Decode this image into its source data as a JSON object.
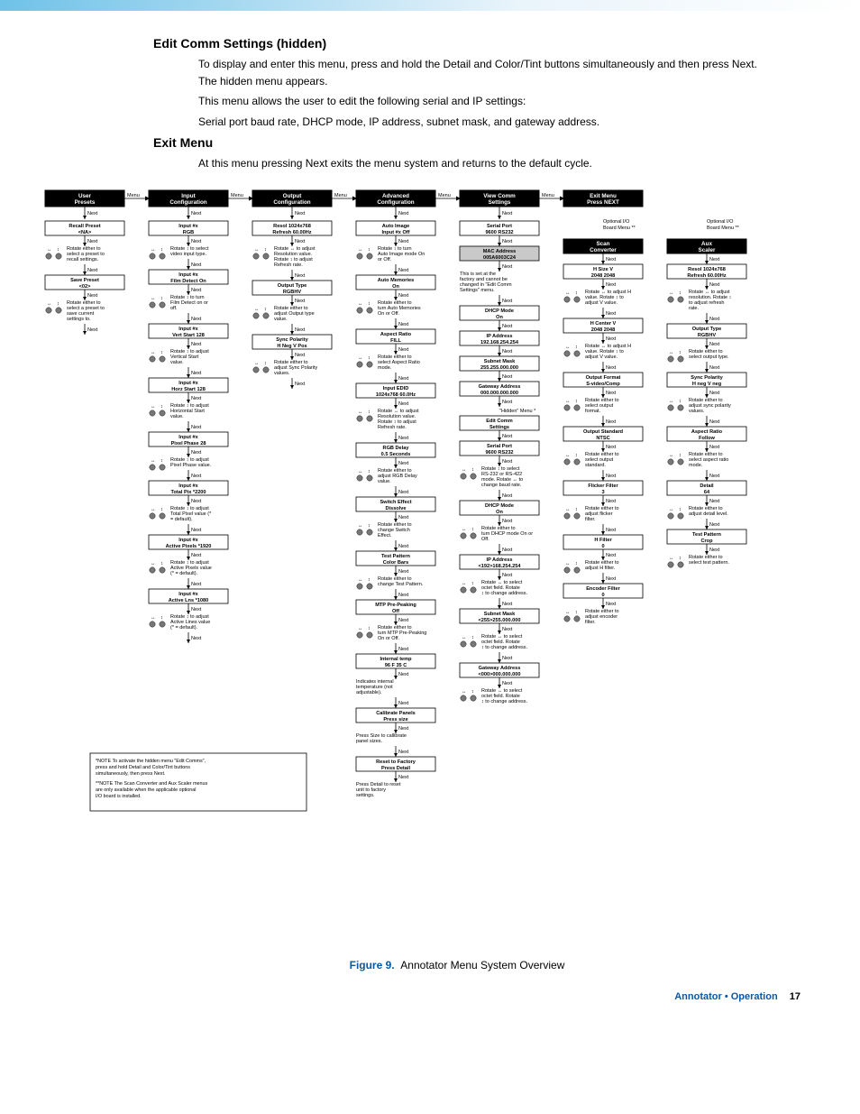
{
  "page_header_bar": true,
  "heading1": "Edit Comm Settings (hidden)",
  "para1": "To display and enter this menu, press and hold the Detail and Color/Tint buttons simultaneously and then press Next. The hidden menu appears.",
  "para2": "This menu allows the user to edit the following serial and IP settings:",
  "para3": "Serial port baud rate, DHCP mode, IP address, subnet mask, and gateway address.",
  "heading2": "Exit Menu",
  "para4": "At this menu pressing Next exits the menu system and returns to the default cycle.",
  "columns": {
    "c1": {
      "title": "User\nPresets",
      "n": [
        {
          "t": "box",
          "l": [
            "Recall Preset",
            "<NA>"
          ]
        },
        {
          "t": "d",
          "l": "Rotate either to select a preset to recall settings."
        },
        {
          "t": "box",
          "l": [
            "Save Preset",
            "<02>"
          ]
        },
        {
          "t": "d",
          "l": "Rotate either to select a preset to save current settings to."
        }
      ]
    },
    "c2": {
      "title": "Input\nConfiguration",
      "n": [
        {
          "t": "box",
          "l": [
            "Input #x",
            "RGB"
          ]
        },
        {
          "t": "d",
          "l": "Rotate ↕ to select video input type."
        },
        {
          "t": "box",
          "l": [
            "Input #x",
            "Film Detect On"
          ]
        },
        {
          "t": "d",
          "l": "Rotate ↕ to turn Film Detect on or off."
        },
        {
          "t": "box",
          "l": [
            "Input #x",
            "Vert Start  128"
          ]
        },
        {
          "t": "d",
          "l": "Rotate ↕ to adjust Vertical Start value."
        },
        {
          "t": "box",
          "l": [
            "Input #x",
            "Horz Start  128"
          ]
        },
        {
          "t": "d",
          "l": "Rotate ↕ to adjust Horizontal Start value."
        },
        {
          "t": "box",
          "l": [
            "Input #x",
            "Pixel Phase  28"
          ]
        },
        {
          "t": "d",
          "l": "Rotate ↕ to adjust Pixel Phase value."
        },
        {
          "t": "box",
          "l": [
            "Input #x",
            "Total Pix  *2200"
          ]
        },
        {
          "t": "d",
          "l": "Rotate ↕ to adjust Total Pixel value (* = default)."
        },
        {
          "t": "box",
          "l": [
            "Input #x",
            "Active Pixels *1920"
          ]
        },
        {
          "t": "d",
          "l": "Rotate ↕ to adjust Active Pixels value (* = default)."
        },
        {
          "t": "box",
          "l": [
            "Input #x",
            "Active Lns  *1080"
          ]
        },
        {
          "t": "d",
          "l": "Rotate ↕ to adjust Active Lines value (* = default)."
        }
      ]
    },
    "c3": {
      "title": "Output\nConfiguration",
      "n": [
        {
          "t": "box",
          "l": [
            "Resol 1024x768",
            "Refresh 60.00Hz"
          ]
        },
        {
          "t": "d",
          "l": "Rotate ↔ to adjust Resolution value. Rotate ↕ to adjust Refresh rate."
        },
        {
          "t": "box",
          "l": [
            "Output Type",
            "RGBHV"
          ]
        },
        {
          "t": "d",
          "l": "Rotate either to adjust Output type value."
        },
        {
          "t": "box",
          "l": [
            "Sync Polarity",
            "H Neg        V Pos"
          ]
        },
        {
          "t": "d",
          "l": "Rotate either to adjust Sync Polarity values."
        }
      ]
    },
    "c4": {
      "title": "Advanced\nConfiguration",
      "n": [
        {
          "t": "box",
          "l": [
            "Auto Image",
            "Input #x      Off"
          ]
        },
        {
          "t": "d",
          "l": "Rotate ↕ to turn Auto Image mode On or Off."
        },
        {
          "t": "box",
          "l": [
            "Auto Memories",
            "On"
          ]
        },
        {
          "t": "d",
          "l": "Rotate either to turn Auto Memories On or Off."
        },
        {
          "t": "box",
          "l": [
            "Aspect Ratio",
            "FILL"
          ]
        },
        {
          "t": "d",
          "l": "Rotate either to select Aspect Ratio mode."
        },
        {
          "t": "box",
          "l": [
            "Input EDID",
            "1024x768    60.0Hz"
          ]
        },
        {
          "t": "d",
          "l": "Rotate ↔ to adjust Resolution value. Rotate ↕ to adjust Refresh rate."
        },
        {
          "t": "box",
          "l": [
            "RGB Delay",
            "0.5 Seconds"
          ]
        },
        {
          "t": "d",
          "l": "Rotate either to adjust RGB Delay value."
        },
        {
          "t": "box",
          "l": [
            "Switch Effect",
            "Dissolve"
          ]
        },
        {
          "t": "d",
          "l": "Rotate either to change Switch Effect."
        },
        {
          "t": "box",
          "l": [
            "Test Pattern",
            "Color Bars"
          ]
        },
        {
          "t": "d",
          "l": "Rotate either to change Test Pattern."
        },
        {
          "t": "box",
          "l": [
            "MTP Pre-Peaking",
            "Off"
          ]
        },
        {
          "t": "d",
          "l": "Rotate either to turn MTP Pre-Peaking On or Off."
        },
        {
          "t": "box",
          "l": [
            "Internal temp",
            "96 F        35 C"
          ]
        },
        {
          "t": "plain",
          "l": "Indicates internal temperature (not adjustable)."
        },
        {
          "t": "box",
          "l": [
            "Calibrate Panels",
            "Press size"
          ]
        },
        {
          "t": "plain",
          "l": "Press Size to callibrate panel sizes."
        },
        {
          "t": "box",
          "l": [
            "Reset to Factory",
            "Press Detail"
          ]
        },
        {
          "t": "plain",
          "l": "Press Detail to reset unit to factory settings.",
          "nonext": true
        }
      ]
    },
    "c5": {
      "title": "View Comm\nSettings",
      "n": [
        {
          "t": "box",
          "l": [
            "Serial Port",
            "9600      RS232"
          ]
        },
        {
          "t": "shade",
          "l": [
            "MAC Address",
            "005A6003C24"
          ]
        },
        {
          "t": "plain",
          "l": "This is set at the factory and cannot be changed in \"Edit Comm Settings\" menu."
        },
        {
          "t": "box",
          "l": [
            "DHCP Mode",
            "On"
          ]
        },
        {
          "t": "box",
          "l": [
            "IP Address",
            "192.168.254.254"
          ]
        },
        {
          "t": "box",
          "l": [
            "Subnet Mask",
            "255.255.000.000"
          ]
        },
        {
          "t": "box",
          "l": [
            "Gateway Address",
            "000.000.000.000"
          ]
        },
        {
          "t": "hm",
          "l": "\"Hidden\" Menu *"
        },
        {
          "t": "sep",
          "l": [
            "Edit Comm",
            "Settings"
          ]
        },
        {
          "t": "box",
          "l": [
            "Serial Port",
            "9600      RS232"
          ]
        },
        {
          "t": "d",
          "l": "Rotate ↕ to select RS-232 or RS-422 mode. Rotate ↔ to change baud rate."
        },
        {
          "t": "box",
          "l": [
            "DHCP Mode",
            "On"
          ]
        },
        {
          "t": "d",
          "l": "Rotate either to turn DHCP mode On or Off."
        },
        {
          "t": "box",
          "l": [
            "IP Address",
            "<192>168.254.254"
          ]
        },
        {
          "t": "d",
          "l": "Rotate ↔ to select octet field. Rotate ↕ to change address."
        },
        {
          "t": "box",
          "l": [
            "Subnet Mask",
            "<255>255.000.000"
          ]
        },
        {
          "t": "d",
          "l": "Rotate ↔ to select octet field. Rotate ↕ to change address."
        },
        {
          "t": "box",
          "l": [
            "Gateway Address",
            "<000>000.000.000"
          ]
        },
        {
          "t": "d",
          "l": "Rotate ↔ to select octet field. Rotate ↕ to change address.",
          "nonext": true
        }
      ]
    },
    "c6": {
      "title": "Exit Menu\nPress NEXT",
      "iol": "Optional I/O\nBoard Menu **",
      "sub": [
        "Scan",
        "Converter"
      ],
      "n": [
        {
          "t": "box",
          "l": [
            "H      Size      V",
            "2048           2048"
          ]
        },
        {
          "t": "d",
          "l": "Rotate ↔ to adjust H value. Rotate ↕ to adjust V value."
        },
        {
          "t": "box",
          "l": [
            "H     Center    V",
            "2048           2048"
          ]
        },
        {
          "t": "d",
          "l": "Rotate ↔ to adjust H value. Rotate ↕ to adjust V value."
        },
        {
          "t": "box",
          "l": [
            "Output Format",
            "S-video/Comp"
          ]
        },
        {
          "t": "d",
          "l": "Rotate either to select output format."
        },
        {
          "t": "box",
          "l": [
            "Output Standard",
            "NTSC"
          ]
        },
        {
          "t": "d",
          "l": "Rotate either to select output standard."
        },
        {
          "t": "box",
          "l": [
            "Flicker Filter",
            "3"
          ]
        },
        {
          "t": "d",
          "l": "Rotate either to adjust flicker filter."
        },
        {
          "t": "box",
          "l": [
            "H Filter",
            "0"
          ]
        },
        {
          "t": "d",
          "l": "Rotate either to adjust H filter."
        },
        {
          "t": "box",
          "l": [
            "Encoder Filter",
            "0"
          ]
        },
        {
          "t": "d",
          "l": "Rotate either to adjust encoder filter.",
          "nonext": true
        }
      ]
    },
    "c7": {
      "iol": "Optional I/O\nBoard Menu **",
      "sub": [
        "Aux",
        "Scaler"
      ],
      "n": [
        {
          "t": "box",
          "l": [
            "Resol   1024x768",
            "Refresh   60.00Hz"
          ]
        },
        {
          "t": "d",
          "l": "Rotate ↔ to adjust resolution. Rotate ↕ to adjust refresh rate."
        },
        {
          "t": "box",
          "l": [
            "Output Type",
            "RGBHV"
          ]
        },
        {
          "t": "d",
          "l": "Rotate either to select output type."
        },
        {
          "t": "box",
          "l": [
            "Sync Polarity",
            "H neg       V neg"
          ]
        },
        {
          "t": "d",
          "l": "Rotate either to adjust sync polarity values."
        },
        {
          "t": "box",
          "l": [
            "Aspect Ratio",
            "Follow"
          ]
        },
        {
          "t": "d",
          "l": "Rotate either to select aspect ratio mode."
        },
        {
          "t": "box",
          "l": [
            "Detail",
            "64"
          ]
        },
        {
          "t": "d",
          "l": "Rotate either to adjust detail level."
        },
        {
          "t": "box",
          "l": [
            "Test Pattern",
            "Crop"
          ]
        },
        {
          "t": "d",
          "l": "Rotate either to select test pattern.",
          "nonext": true
        }
      ]
    }
  },
  "notes": [
    "*NOTE  To activate the hidden menu \"Edit Comms\", press and hold Detail and Color/Tint buttons simultaneously, then press Next.",
    "**NOTE  The Scan Converter and Aux Scaler menus are only available when the applicable optional I/O board is installed."
  ],
  "figure_caption_num": "Figure 9.",
  "figure_caption": "Annotator Menu System Overview",
  "footer_title": "Annotator • Operation",
  "page_number": "17",
  "next_label": "Next",
  "menu_label": "Menu"
}
